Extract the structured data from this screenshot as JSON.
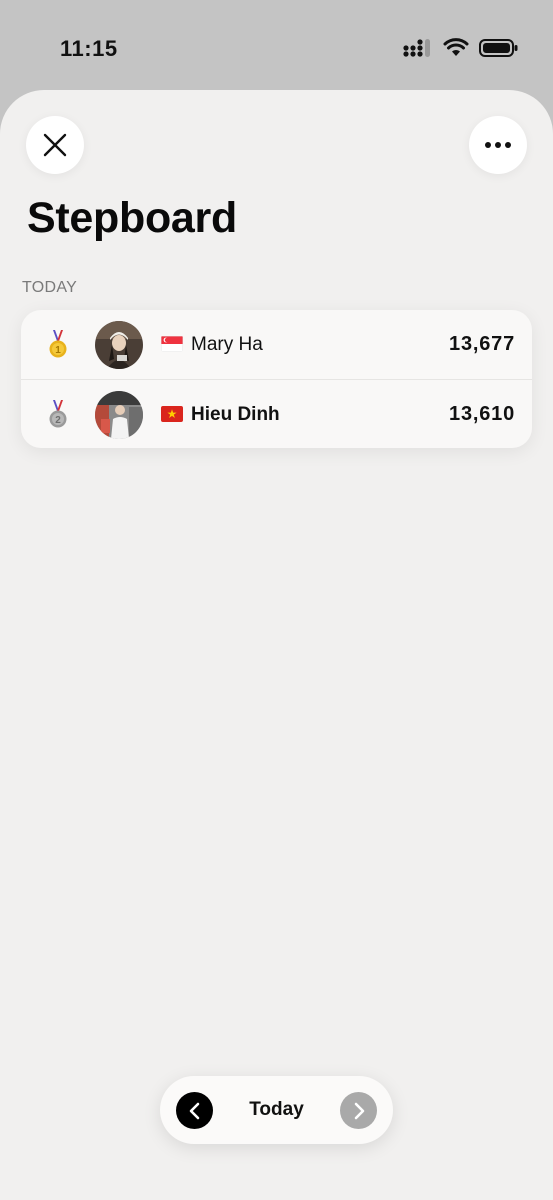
{
  "status_bar": {
    "time": "11:15",
    "icons": [
      "cellular-signal-icon",
      "wifi-icon",
      "battery-icon"
    ]
  },
  "header": {
    "close_icon": "close-icon",
    "more_icon": "more-icon",
    "title": "Stepboard"
  },
  "section": {
    "label": "TODAY"
  },
  "leaderboard": [
    {
      "rank": 1,
      "medal": "gold-medal-icon",
      "flag": "singapore-flag-icon",
      "name": "Mary Ha",
      "steps": "13,677"
    },
    {
      "rank": 2,
      "medal": "silver-medal-icon",
      "flag": "vietnam-flag-icon",
      "name": "Hieu Dinh",
      "steps": "13,610"
    }
  ],
  "pager": {
    "label": "Today",
    "prev_icon": "chevron-left-icon",
    "next_icon": "chevron-right-icon"
  },
  "colors": {
    "sheet_background": "#f1f0ef",
    "status_background": "#c4c4c4",
    "gold": "#e8b21c",
    "silver": "#a6a6a6"
  }
}
